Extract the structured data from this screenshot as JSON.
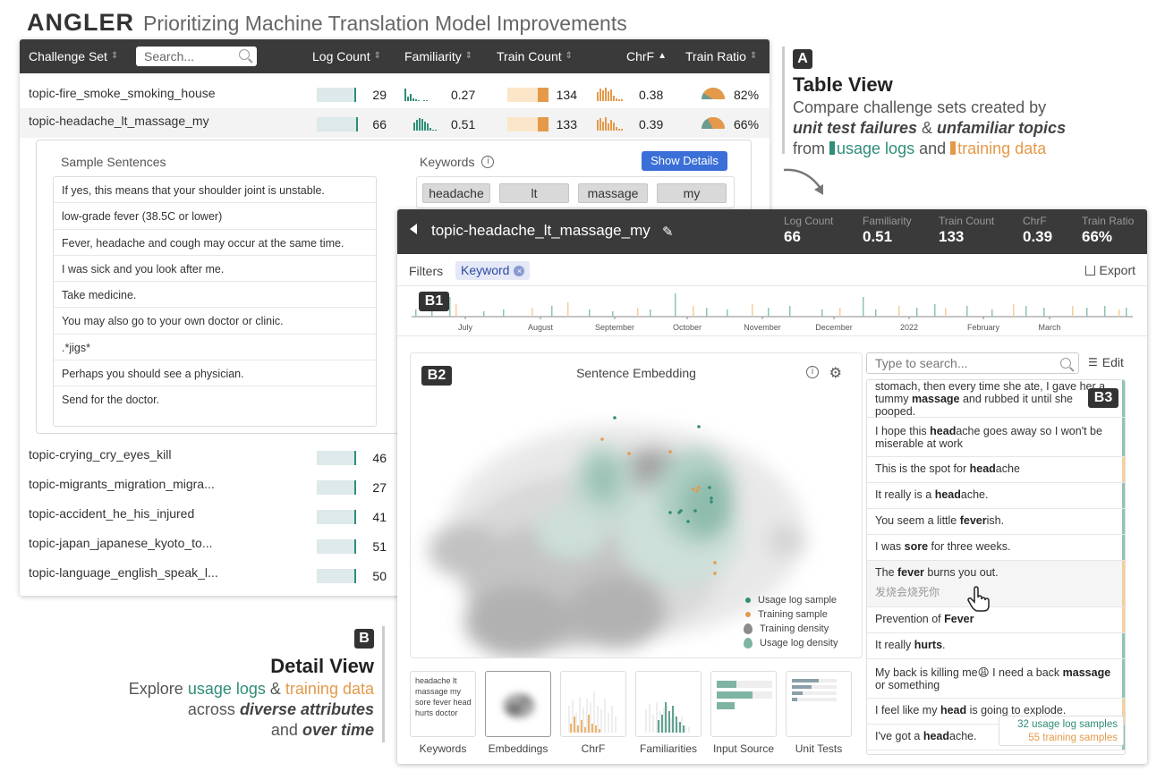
{
  "app": {
    "logo": "ANGLER",
    "title": "Prioritizing Machine Translation Model Improvements"
  },
  "table": {
    "columns": {
      "challenge_set": "Challenge Set",
      "log_count": "Log Count",
      "familiarity": "Familiarity",
      "train_count": "Train Count",
      "chrf": "ChrF",
      "train_ratio": "Train Ratio"
    },
    "search_placeholder": "Search...",
    "rows": [
      {
        "name": "topic-fire_smoke_smoking_house",
        "log_count": "29",
        "familiarity": "0.27",
        "train_count": "134",
        "chrf": "0.38",
        "train_ratio": "82%",
        "ratio_value": 0.82
      },
      {
        "name": "topic-headache_lt_massage_my",
        "log_count": "66",
        "familiarity": "0.51",
        "train_count": "133",
        "chrf": "0.39",
        "train_ratio": "66%",
        "ratio_value": 0.66
      },
      {
        "name": "topic-crying_cry_eyes_kill",
        "log_count": "46"
      },
      {
        "name": "topic-migrants_migration_migra...",
        "log_count": "27"
      },
      {
        "name": "topic-accident_he_his_injured",
        "log_count": "41"
      },
      {
        "name": "topic-japan_japanese_kyoto_to...",
        "log_count": "51"
      },
      {
        "name": "topic-language_english_speak_l...",
        "log_count": "50"
      }
    ],
    "expanded": {
      "sample_label": "Sample Sentences",
      "samples": [
        "If yes, this means that your shoulder joint is unstable.",
        "low-grade fever (38.5C or lower)",
        "Fever, headache and cough may occur at the same time.",
        "I was sick and you look after me.",
        "Take medicine.",
        "You may also go to your own doctor or clinic.",
        ".*jigs*",
        "Perhaps you should see a physician.",
        "Send for the doctor."
      ],
      "keywords_label": "Keywords",
      "show_details": "Show Details",
      "keywords": [
        "headache",
        "lt",
        "massage",
        "my"
      ]
    }
  },
  "annotation_a": {
    "badge": "A",
    "title": "Table View",
    "line1": "Compare challenge sets created by",
    "line2_a": "unit test failures",
    "line2_b": " & ",
    "line2_c": "unfamiliar topics",
    "line3_a": "from ",
    "line3_b": "usage logs",
    "line3_c": " and ",
    "line3_d": "training data"
  },
  "annotation_b": {
    "badge": "B",
    "title": "Detail View",
    "line1_a": "Explore ",
    "line1_b": "usage logs",
    "line1_c": " & ",
    "line1_d": "training data",
    "line2_a": "across ",
    "line2_b": "diverse attributes",
    "line3_a": "and ",
    "line3_b": "over time"
  },
  "detail": {
    "title": "topic-headache_lt_massage_my",
    "stats": [
      {
        "label": "Log Count",
        "value": "66"
      },
      {
        "label": "Familiarity",
        "value": "0.51"
      },
      {
        "label": "Train Count",
        "value": "133"
      },
      {
        "label": "ChrF",
        "value": "0.39"
      },
      {
        "label": "Train Ratio",
        "value": "66%"
      }
    ],
    "filters_label": "Filters",
    "filter_chip": "Keyword",
    "export_label": "Export",
    "timeline_badge": "B1",
    "timeline_months": [
      "July",
      "August",
      "September",
      "October",
      "November",
      "December",
      "2022",
      "February",
      "March"
    ],
    "embedding_badge": "B2",
    "embedding_title": "Sentence Embedding",
    "legend": [
      "Usage log sample",
      "Training sample",
      "Training density",
      "Usage log density"
    ],
    "thumb_labels": [
      "Keywords",
      "Embeddings",
      "ChrF",
      "Familiarities",
      "Input Source",
      "Unit Tests"
    ],
    "thumb_keywords": "headache lt massage my sore fever head hurts doctor",
    "list_badge": "B3",
    "search_placeholder": "Type to search...",
    "edit_label": "Edit",
    "counts": {
      "usage": "32 usage log samples",
      "training": "55 training samples"
    }
  },
  "colors": {
    "usage": "#2f8d78",
    "training": "#e49a4a",
    "header": "#3a3a3a",
    "accent": "#3a6fd8"
  }
}
